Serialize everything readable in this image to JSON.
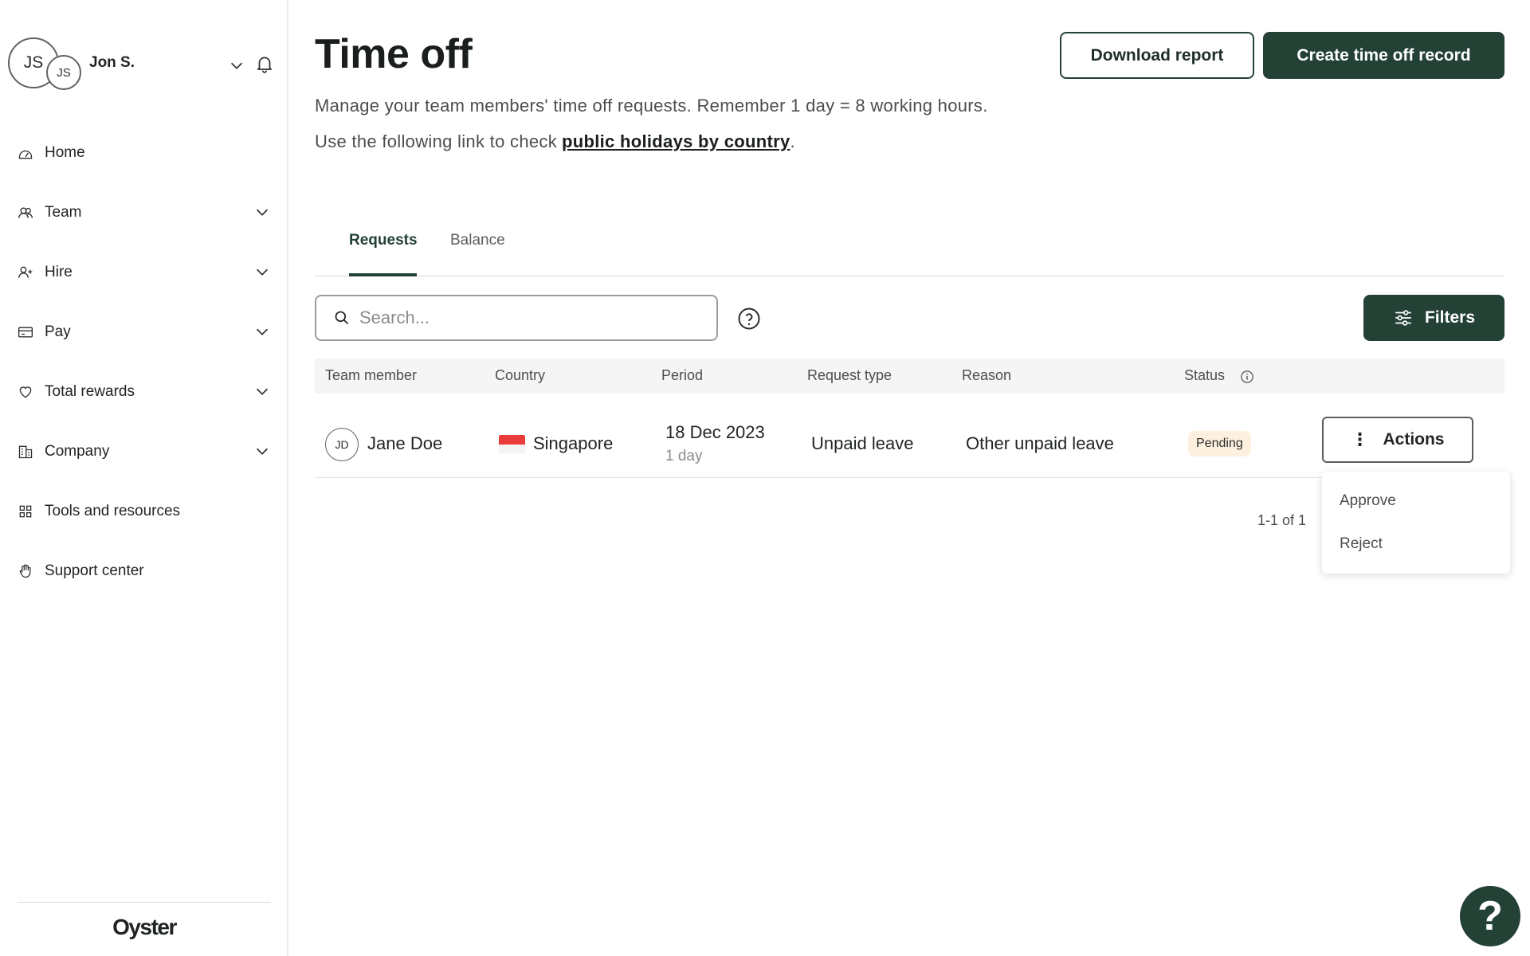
{
  "user": {
    "initials_main": "JS",
    "initials_secondary": "JS",
    "name": "Jon S."
  },
  "sidebar": {
    "items": [
      {
        "label": "Home",
        "icon": "home-icon"
      },
      {
        "label": "Team",
        "icon": "team-icon"
      },
      {
        "label": "Hire",
        "icon": "hire-icon"
      },
      {
        "label": "Pay",
        "icon": "pay-icon"
      },
      {
        "label": "Total rewards",
        "icon": "heart-icon"
      },
      {
        "label": "Company",
        "icon": "building-icon"
      },
      {
        "label": "Tools and resources",
        "icon": "grid-icon"
      },
      {
        "label": "Support center",
        "icon": "hand-icon"
      }
    ],
    "logo": "Oyster"
  },
  "header": {
    "title": "Time off",
    "download_label": "Download report",
    "create_label": "Create time off record",
    "description_1": "Manage your team members' time off requests. Remember 1 day = 8 working hours.",
    "description_2": "Use the following link to check",
    "link_label": "public holidays by country",
    "description_2_end": "."
  },
  "tabs": [
    {
      "label": "Requests",
      "active": true
    },
    {
      "label": "Balance",
      "active": false
    }
  ],
  "search": {
    "placeholder": "Search..."
  },
  "filters_label": "Filters",
  "table": {
    "columns": [
      "Team member",
      "Country",
      "Period",
      "Request type",
      "Reason",
      "Status"
    ],
    "rows": [
      {
        "initials": "JD",
        "name": "Jane Doe",
        "country": "Singapore",
        "period": "18 Dec 2023",
        "duration": "1 day",
        "request_type": "Unpaid leave",
        "reason": "Other unpaid leave",
        "status": "Pending",
        "actions_label": "Actions"
      }
    ]
  },
  "actions_menu": [
    "Approve",
    "Reject"
  ],
  "pagination": "1-1 of 1",
  "colors": {
    "brand": "#244136",
    "pending_bg": "#fdf0df"
  },
  "help_fab": "?"
}
